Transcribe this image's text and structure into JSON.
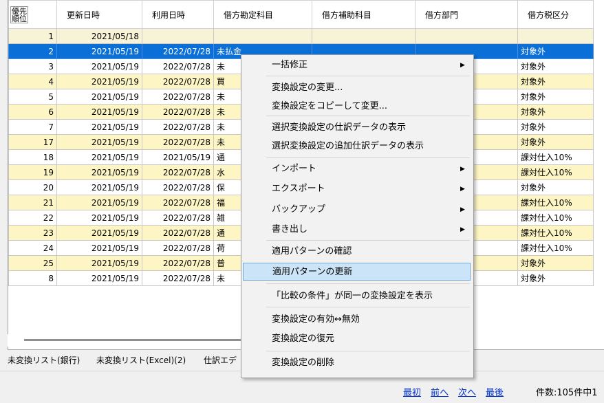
{
  "grid": {
    "columns": [
      "優先\n順位",
      "更新日時",
      "利用日時",
      "借方勘定科目",
      "借方補助科目",
      "借方部門",
      "借方税区分"
    ],
    "rows": [
      {
        "prio": "1",
        "updated": "2021/05/18",
        "used": "",
        "account": "",
        "tax": ""
      },
      {
        "prio": "2",
        "updated": "2021/05/19",
        "used": "2022/07/28",
        "account": "未払金",
        "tax": "対象外"
      },
      {
        "prio": "3",
        "updated": "2021/05/19",
        "used": "2022/07/28",
        "account": "未",
        "tax": "対象外"
      },
      {
        "prio": "4",
        "updated": "2021/05/19",
        "used": "2022/07/28",
        "account": "買",
        "tax": "対象外"
      },
      {
        "prio": "5",
        "updated": "2021/05/19",
        "used": "2022/07/28",
        "account": "未",
        "tax": "対象外"
      },
      {
        "prio": "6",
        "updated": "2021/05/19",
        "used": "2022/07/28",
        "account": "未",
        "tax": "対象外"
      },
      {
        "prio": "7",
        "updated": "2021/05/19",
        "used": "2022/07/28",
        "account": "未",
        "tax": "対象外"
      },
      {
        "prio": "17",
        "updated": "2021/05/19",
        "used": "2022/07/28",
        "account": "未",
        "tax": "対象外"
      },
      {
        "prio": "18",
        "updated": "2021/05/19",
        "used": "2021/05/19",
        "account": "通",
        "tax": "課対仕入10%"
      },
      {
        "prio": "19",
        "updated": "2021/05/19",
        "used": "2022/07/28",
        "account": "水",
        "tax": "課対仕入10%"
      },
      {
        "prio": "20",
        "updated": "2021/05/19",
        "used": "2022/07/28",
        "account": "保",
        "tax": "対象外"
      },
      {
        "prio": "21",
        "updated": "2021/05/19",
        "used": "2022/07/28",
        "account": "福",
        "tax": "課対仕入10%"
      },
      {
        "prio": "22",
        "updated": "2021/05/19",
        "used": "2022/07/28",
        "account": "雑",
        "tax": "課対仕入10%"
      },
      {
        "prio": "23",
        "updated": "2021/05/19",
        "used": "2022/07/28",
        "account": "通",
        "tax": "課対仕入10%"
      },
      {
        "prio": "24",
        "updated": "2021/05/19",
        "used": "2022/07/28",
        "account": "荷",
        "tax": "課対仕入10%"
      },
      {
        "prio": "25",
        "updated": "2021/05/19",
        "used": "2022/07/28",
        "account": "普",
        "tax": "対象外"
      },
      {
        "prio": "8",
        "updated": "2021/05/19",
        "used": "2022/07/28",
        "account": "未",
        "tax": "対象外"
      }
    ]
  },
  "tabs": [
    "未変換リスト(銀行)",
    "未変換リスト(Excel)(2)",
    "仕訳エデ"
  ],
  "pager": {
    "first": "最初",
    "prev": "前へ",
    "next": "次へ",
    "last": "最後",
    "count": "件数:105件中1"
  },
  "context_menu": {
    "items": [
      {
        "label": "一括修正",
        "submenu": true
      },
      {
        "label": "変換設定の変更..."
      },
      {
        "label": "変換設定をコピーして変更..."
      },
      {
        "label": "選択変換設定の仕訳データの表示"
      },
      {
        "label": "選択変換設定の追加仕訳データの表示"
      },
      {
        "label": "インポート",
        "submenu": true
      },
      {
        "label": "エクスポート",
        "submenu": true
      },
      {
        "label": "バックアップ",
        "submenu": true
      },
      {
        "label": "書き出し",
        "submenu": true
      },
      {
        "label": "適用パターンの確認"
      },
      {
        "label": "適用パターンの更新",
        "highlighted": true
      },
      {
        "label": "「比較の条件」が同一の変換設定を表示"
      },
      {
        "label": "変換設定の有効↔無効"
      },
      {
        "label": "変換設定の復元"
      },
      {
        "label": "変換設定の削除"
      }
    ],
    "submenu_arrow": "▶"
  }
}
